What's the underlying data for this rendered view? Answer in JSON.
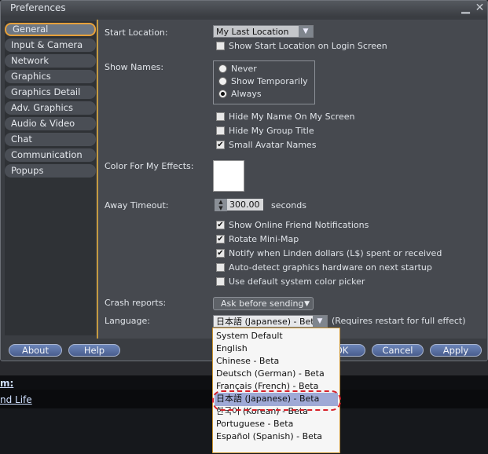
{
  "window": {
    "title": "Preferences",
    "minimize_glyph": "▁",
    "close_glyph": "✕"
  },
  "sidebar": {
    "items": [
      {
        "label": "General"
      },
      {
        "label": "Input & Camera"
      },
      {
        "label": "Network"
      },
      {
        "label": "Graphics"
      },
      {
        "label": "Graphics Detail"
      },
      {
        "label": "Adv. Graphics"
      },
      {
        "label": "Audio & Video"
      },
      {
        "label": "Chat"
      },
      {
        "label": "Communication"
      },
      {
        "label": "Popups"
      }
    ]
  },
  "general": {
    "start_location": {
      "label": "Start Location:",
      "value": "My Last Location",
      "show_on_login": "Show Start Location on Login Screen"
    },
    "show_names": {
      "label": "Show Names:",
      "options": [
        "Never",
        "Show Temporarily",
        "Always"
      ],
      "selected": "Always"
    },
    "checks_a": [
      {
        "label": "Hide My Name On My Screen",
        "checked": false
      },
      {
        "label": "Hide My Group Title",
        "checked": false
      },
      {
        "label": "Small Avatar Names",
        "checked": true
      }
    ],
    "effects_color": {
      "label": "Color For My Effects:",
      "color": "#ffffff"
    },
    "away_timeout": {
      "label": "Away Timeout:",
      "value": "300.00",
      "unit": "seconds"
    },
    "checks_b": [
      {
        "label": "Show Online Friend Notifications",
        "checked": true
      },
      {
        "label": "Rotate Mini-Map",
        "checked": true
      },
      {
        "label": "Notify when Linden dollars (L$) spent or received",
        "checked": true
      },
      {
        "label": "Auto-detect graphics hardware on next startup",
        "checked": false
      },
      {
        "label": "Use default system color picker",
        "checked": false
      }
    ],
    "crash_reports": {
      "label": "Crash reports:",
      "value": "Ask before sending"
    },
    "language": {
      "label": "Language:",
      "value": "日本語 (Japanese) - Bet",
      "note": "(Requires restart for full effect)",
      "options": [
        "System Default",
        "English",
        "Chinese - Beta",
        "Deutsch (German) - Beta",
        "Français (French) - Beta",
        "日本語 (Japanese) - Beta",
        "한국어 (Korean) - Beta",
        "Portuguese - Beta",
        "Español (Spanish) - Beta"
      ],
      "highlighted": "日本語 (Japanese) - Beta"
    }
  },
  "buttons": {
    "about": "About",
    "help": "Help",
    "ok": "OK",
    "cancel": "Cancel",
    "apply": "Apply"
  },
  "background": {
    "line1": "m:",
    "line2": "nd Life"
  }
}
